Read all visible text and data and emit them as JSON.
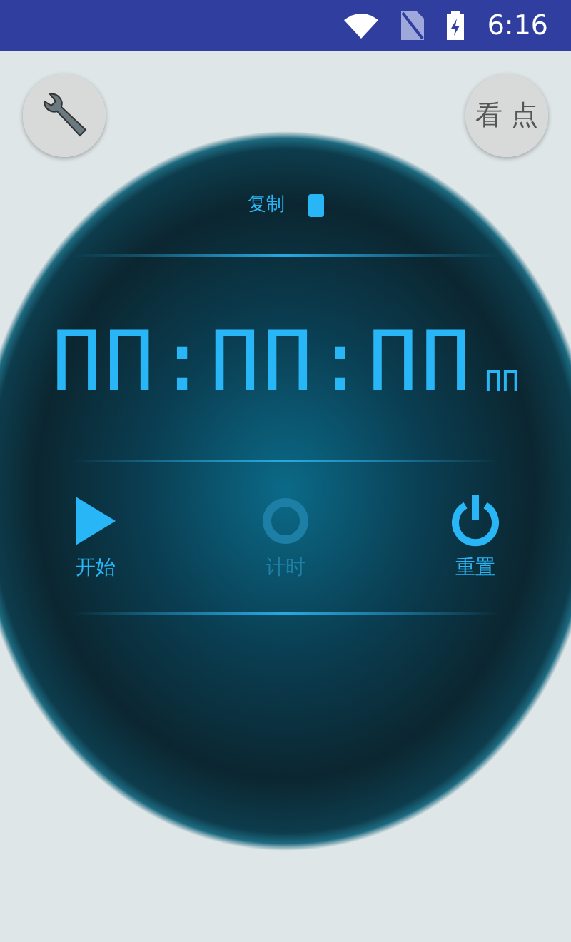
{
  "status_bar": {
    "time": "6:16"
  },
  "top_buttons": {
    "right_label": "看 点"
  },
  "copy": {
    "label": "复制",
    "on": true
  },
  "display": {
    "time": "ΠΠ:ΠΠ:ΠΠ",
    "fraction": "ΠΠ"
  },
  "controls": [
    {
      "kind": "play",
      "label": "开始",
      "disabled": false
    },
    {
      "kind": "ring",
      "label": "计时",
      "disabled": true
    },
    {
      "kind": "power",
      "label": "重置",
      "disabled": false
    }
  ]
}
